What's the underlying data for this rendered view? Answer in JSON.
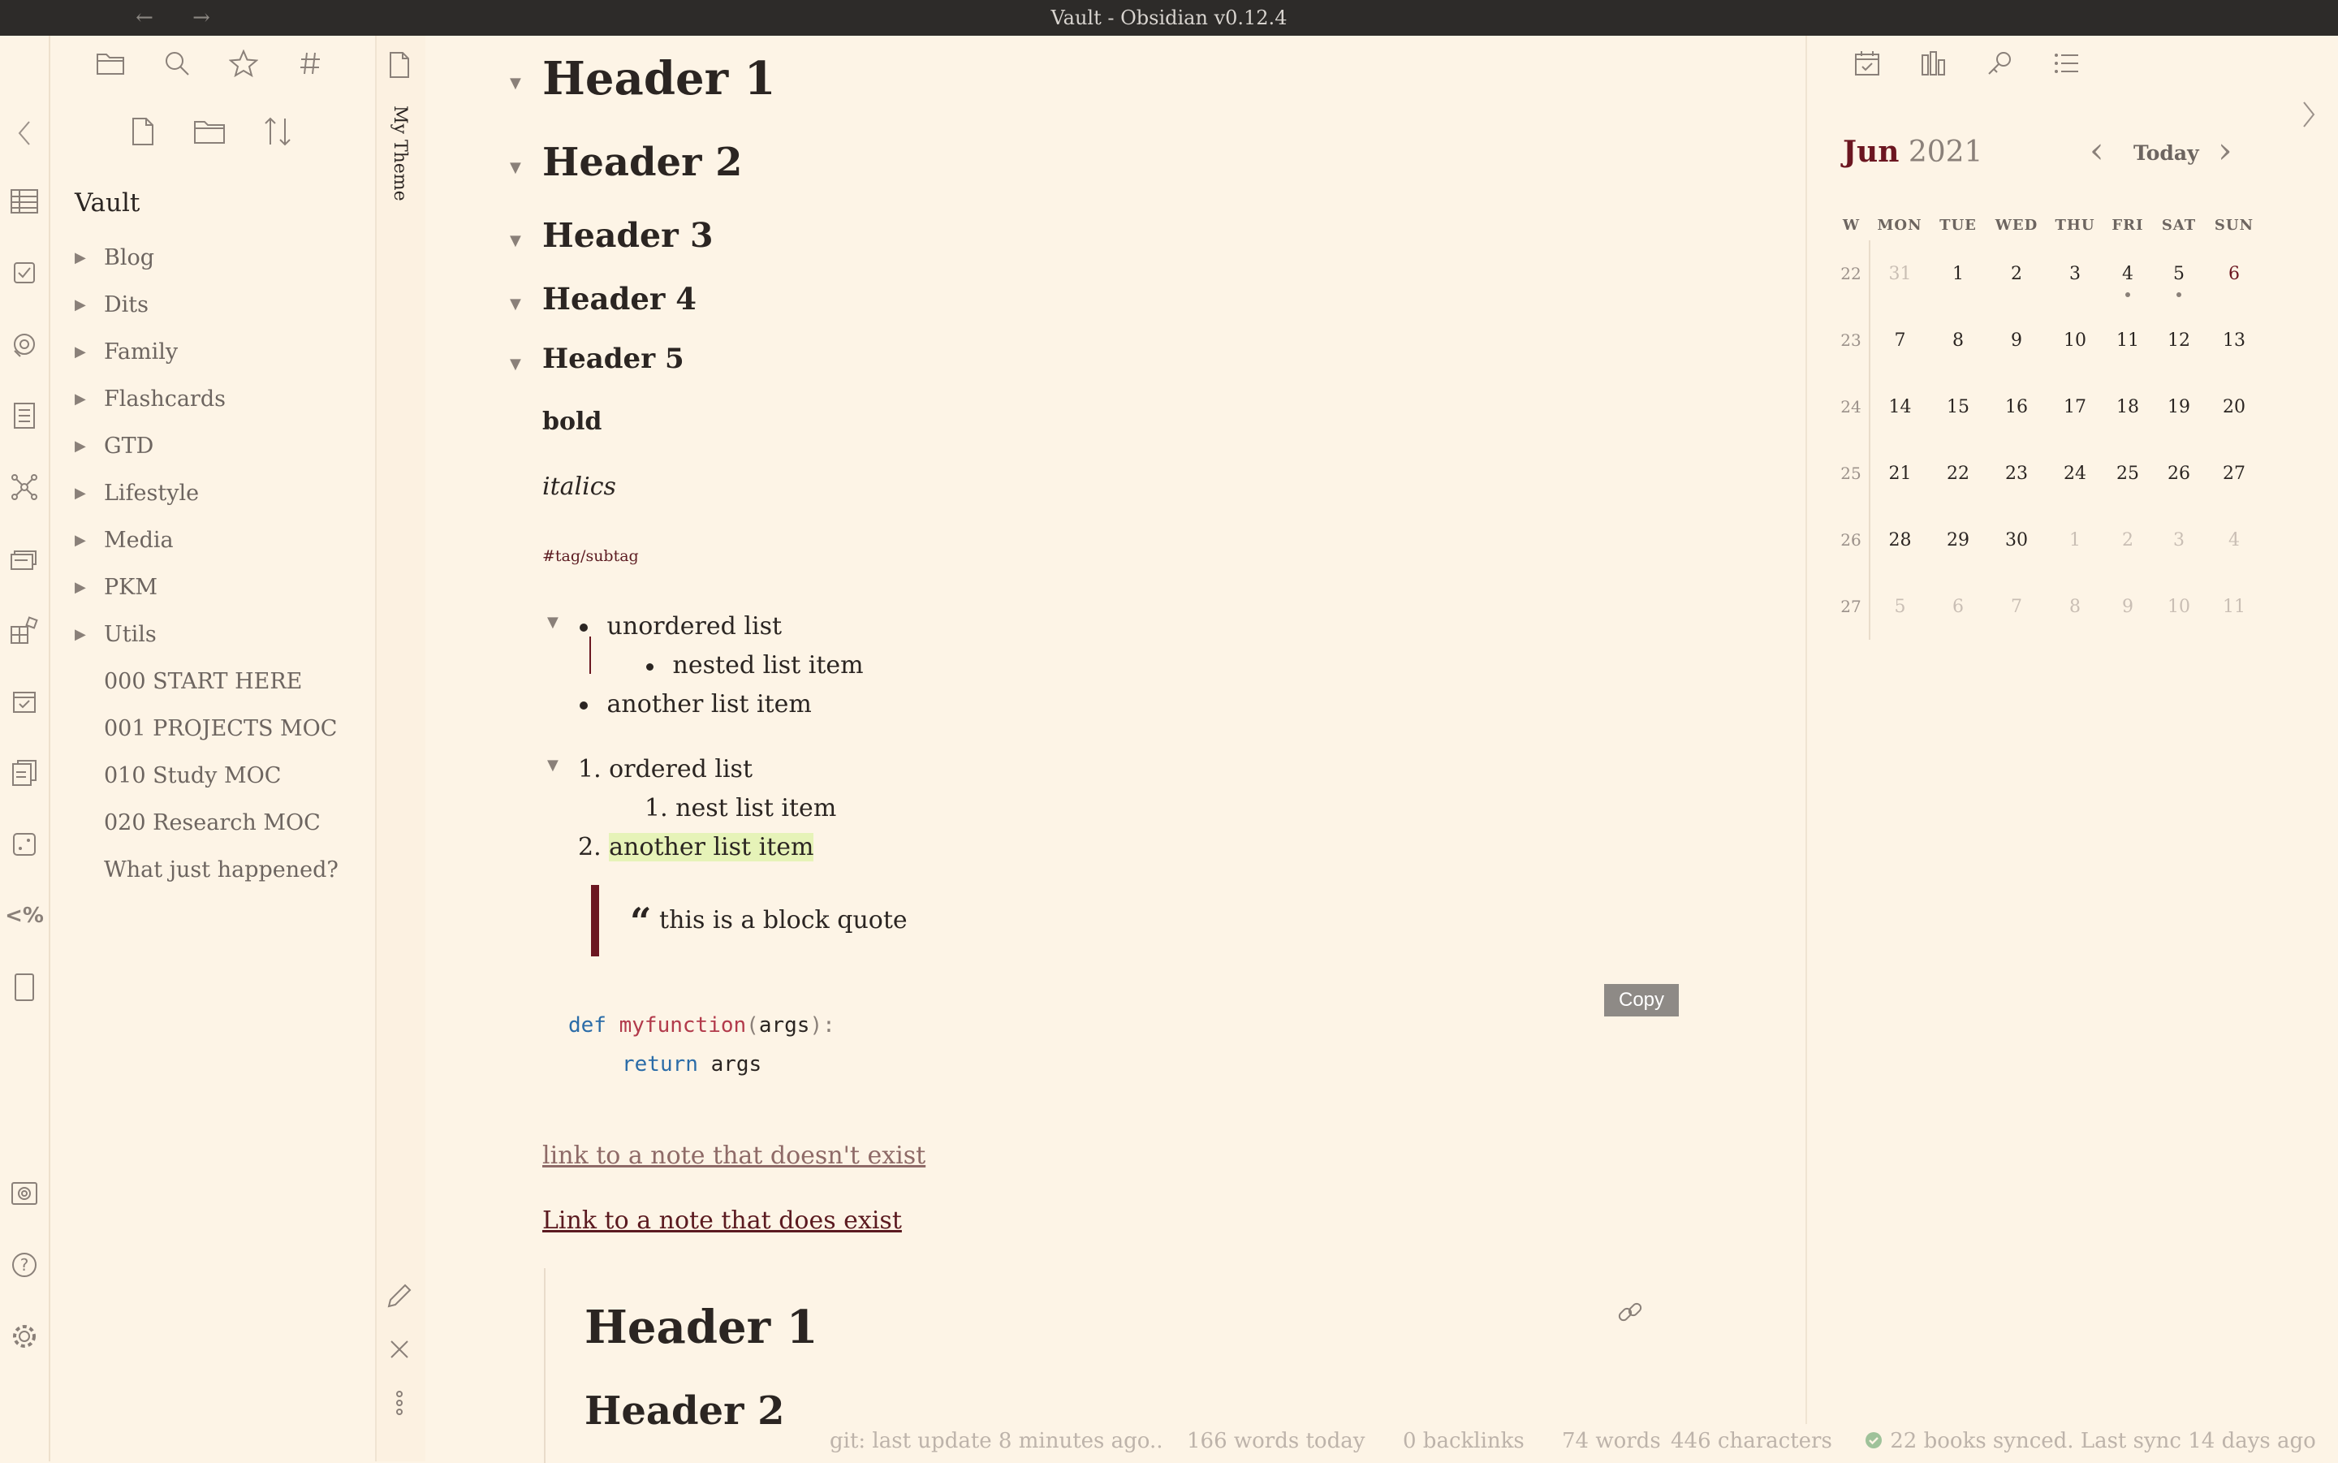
{
  "window": {
    "title": "Vault - Obsidian v0.12.4",
    "back_glyph": "←",
    "forward_glyph": "→"
  },
  "ribbon": {
    "icons": [
      "collapse-left-icon",
      "table-icon",
      "checkbox-icon",
      "dice-icon",
      "document-list-icon",
      "graph-icon",
      "cards-icon",
      "grid-icon",
      "calendar-icon",
      "pages-icon",
      "dice-box-icon",
      "templater-icon",
      "tablet-icon",
      "vault-switch-icon",
      "help-icon",
      "settings-icon"
    ],
    "templater_label": "<%"
  },
  "file_explorer": {
    "tabs": [
      "folder-icon",
      "search-icon",
      "star-icon",
      "hash-icon"
    ],
    "actions": [
      "new-note-icon",
      "new-folder-icon",
      "sort-icon"
    ],
    "vault_name": "Vault",
    "folders": [
      "Blog",
      "Dits",
      "Family",
      "Flashcards",
      "GTD",
      "Lifestyle",
      "Media",
      "PKM",
      "Utils"
    ],
    "files": [
      "000 START HERE",
      "001 PROJECTS MOC",
      "010 Study MOC",
      "020 Research MOC",
      "What just happened?"
    ]
  },
  "side_strip": {
    "tab_label": "My Theme"
  },
  "editor": {
    "headers": [
      "Header 1",
      "Header 2",
      "Header 3",
      "Header 4",
      "Header 5"
    ],
    "bold": "bold",
    "italics": "italics",
    "tag": "#tag/subtag",
    "unordered": {
      "item1": "unordered list",
      "nested": "nested list item",
      "item2": "another list item"
    },
    "ordered": {
      "n1": "1.",
      "item1": "ordered list",
      "n_nested": "1.",
      "nested": "nest list item",
      "n2": "2.",
      "item2": "another list item"
    },
    "quote": {
      "mark": "“",
      "text": "this is a block quote"
    },
    "code": {
      "copy_label": "Copy",
      "def": "def",
      "fn": "myfunction",
      "open": "(",
      "args": "args",
      "close": "):",
      "return": "return",
      "ret_val": "args"
    },
    "link_missing": "link to a note that doesn't exist",
    "link_exists": "Link to a note that does exist",
    "embed": {
      "h1": "Header 1",
      "h2": "Header 2"
    }
  },
  "calendar": {
    "month": "Jun",
    "year": "2021",
    "today_label": "Today",
    "prev_glyph": "‹",
    "next_glyph": "›",
    "headers": [
      "W",
      "MON",
      "TUE",
      "WED",
      "THU",
      "FRI",
      "SAT",
      "SUN"
    ],
    "weeks": [
      {
        "w": "22",
        "days": [
          "31",
          "1",
          "2",
          "3",
          "4",
          "5",
          "6"
        ]
      },
      {
        "w": "23",
        "days": [
          "7",
          "8",
          "9",
          "10",
          "11",
          "12",
          "13"
        ]
      },
      {
        "w": "24",
        "days": [
          "14",
          "15",
          "16",
          "17",
          "18",
          "19",
          "20"
        ]
      },
      {
        "w": "25",
        "days": [
          "21",
          "22",
          "23",
          "24",
          "25",
          "26",
          "27"
        ]
      },
      {
        "w": "26",
        "days": [
          "28",
          "29",
          "30",
          "1",
          "2",
          "3",
          "4"
        ]
      },
      {
        "w": "27",
        "days": [
          "5",
          "6",
          "7",
          "8",
          "9",
          "10",
          "11"
        ]
      }
    ]
  },
  "right_toolbar": {
    "icons": [
      "calendar-check-icon",
      "bar-chart-icon",
      "tag-pane-icon",
      "outline-icon"
    ]
  },
  "status_bar": {
    "git": "git: last update 8 minutes ago..",
    "words_today": "166 words today",
    "backlinks": "0 backlinks",
    "words": "74 words",
    "characters": "446 characters",
    "sync": "22 books synced. Last sync 14 days ago"
  },
  "colors": {
    "background": "#fdf4e6",
    "accent": "#6b1620",
    "titlebar": "#2d2b29"
  }
}
